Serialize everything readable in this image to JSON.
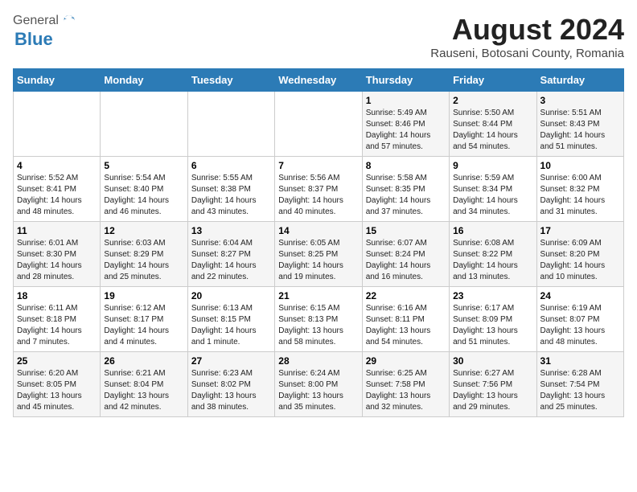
{
  "header": {
    "logo_general": "General",
    "logo_blue": "Blue",
    "month_year": "August 2024",
    "location": "Rauseni, Botosani County, Romania"
  },
  "weekdays": [
    "Sunday",
    "Monday",
    "Tuesday",
    "Wednesday",
    "Thursday",
    "Friday",
    "Saturday"
  ],
  "weeks": [
    [
      {
        "day": "",
        "info": ""
      },
      {
        "day": "",
        "info": ""
      },
      {
        "day": "",
        "info": ""
      },
      {
        "day": "",
        "info": ""
      },
      {
        "day": "1",
        "info": "Sunrise: 5:49 AM\nSunset: 8:46 PM\nDaylight: 14 hours\nand 57 minutes."
      },
      {
        "day": "2",
        "info": "Sunrise: 5:50 AM\nSunset: 8:44 PM\nDaylight: 14 hours\nand 54 minutes."
      },
      {
        "day": "3",
        "info": "Sunrise: 5:51 AM\nSunset: 8:43 PM\nDaylight: 14 hours\nand 51 minutes."
      }
    ],
    [
      {
        "day": "4",
        "info": "Sunrise: 5:52 AM\nSunset: 8:41 PM\nDaylight: 14 hours\nand 48 minutes."
      },
      {
        "day": "5",
        "info": "Sunrise: 5:54 AM\nSunset: 8:40 PM\nDaylight: 14 hours\nand 46 minutes."
      },
      {
        "day": "6",
        "info": "Sunrise: 5:55 AM\nSunset: 8:38 PM\nDaylight: 14 hours\nand 43 minutes."
      },
      {
        "day": "7",
        "info": "Sunrise: 5:56 AM\nSunset: 8:37 PM\nDaylight: 14 hours\nand 40 minutes."
      },
      {
        "day": "8",
        "info": "Sunrise: 5:58 AM\nSunset: 8:35 PM\nDaylight: 14 hours\nand 37 minutes."
      },
      {
        "day": "9",
        "info": "Sunrise: 5:59 AM\nSunset: 8:34 PM\nDaylight: 14 hours\nand 34 minutes."
      },
      {
        "day": "10",
        "info": "Sunrise: 6:00 AM\nSunset: 8:32 PM\nDaylight: 14 hours\nand 31 minutes."
      }
    ],
    [
      {
        "day": "11",
        "info": "Sunrise: 6:01 AM\nSunset: 8:30 PM\nDaylight: 14 hours\nand 28 minutes."
      },
      {
        "day": "12",
        "info": "Sunrise: 6:03 AM\nSunset: 8:29 PM\nDaylight: 14 hours\nand 25 minutes."
      },
      {
        "day": "13",
        "info": "Sunrise: 6:04 AM\nSunset: 8:27 PM\nDaylight: 14 hours\nand 22 minutes."
      },
      {
        "day": "14",
        "info": "Sunrise: 6:05 AM\nSunset: 8:25 PM\nDaylight: 14 hours\nand 19 minutes."
      },
      {
        "day": "15",
        "info": "Sunrise: 6:07 AM\nSunset: 8:24 PM\nDaylight: 14 hours\nand 16 minutes."
      },
      {
        "day": "16",
        "info": "Sunrise: 6:08 AM\nSunset: 8:22 PM\nDaylight: 14 hours\nand 13 minutes."
      },
      {
        "day": "17",
        "info": "Sunrise: 6:09 AM\nSunset: 8:20 PM\nDaylight: 14 hours\nand 10 minutes."
      }
    ],
    [
      {
        "day": "18",
        "info": "Sunrise: 6:11 AM\nSunset: 8:18 PM\nDaylight: 14 hours\nand 7 minutes."
      },
      {
        "day": "19",
        "info": "Sunrise: 6:12 AM\nSunset: 8:17 PM\nDaylight: 14 hours\nand 4 minutes."
      },
      {
        "day": "20",
        "info": "Sunrise: 6:13 AM\nSunset: 8:15 PM\nDaylight: 14 hours\nand 1 minute."
      },
      {
        "day": "21",
        "info": "Sunrise: 6:15 AM\nSunset: 8:13 PM\nDaylight: 13 hours\nand 58 minutes."
      },
      {
        "day": "22",
        "info": "Sunrise: 6:16 AM\nSunset: 8:11 PM\nDaylight: 13 hours\nand 54 minutes."
      },
      {
        "day": "23",
        "info": "Sunrise: 6:17 AM\nSunset: 8:09 PM\nDaylight: 13 hours\nand 51 minutes."
      },
      {
        "day": "24",
        "info": "Sunrise: 6:19 AM\nSunset: 8:07 PM\nDaylight: 13 hours\nand 48 minutes."
      }
    ],
    [
      {
        "day": "25",
        "info": "Sunrise: 6:20 AM\nSunset: 8:05 PM\nDaylight: 13 hours\nand 45 minutes."
      },
      {
        "day": "26",
        "info": "Sunrise: 6:21 AM\nSunset: 8:04 PM\nDaylight: 13 hours\nand 42 minutes."
      },
      {
        "day": "27",
        "info": "Sunrise: 6:23 AM\nSunset: 8:02 PM\nDaylight: 13 hours\nand 38 minutes."
      },
      {
        "day": "28",
        "info": "Sunrise: 6:24 AM\nSunset: 8:00 PM\nDaylight: 13 hours\nand 35 minutes."
      },
      {
        "day": "29",
        "info": "Sunrise: 6:25 AM\nSunset: 7:58 PM\nDaylight: 13 hours\nand 32 minutes."
      },
      {
        "day": "30",
        "info": "Sunrise: 6:27 AM\nSunset: 7:56 PM\nDaylight: 13 hours\nand 29 minutes."
      },
      {
        "day": "31",
        "info": "Sunrise: 6:28 AM\nSunset: 7:54 PM\nDaylight: 13 hours\nand 25 minutes."
      }
    ]
  ]
}
